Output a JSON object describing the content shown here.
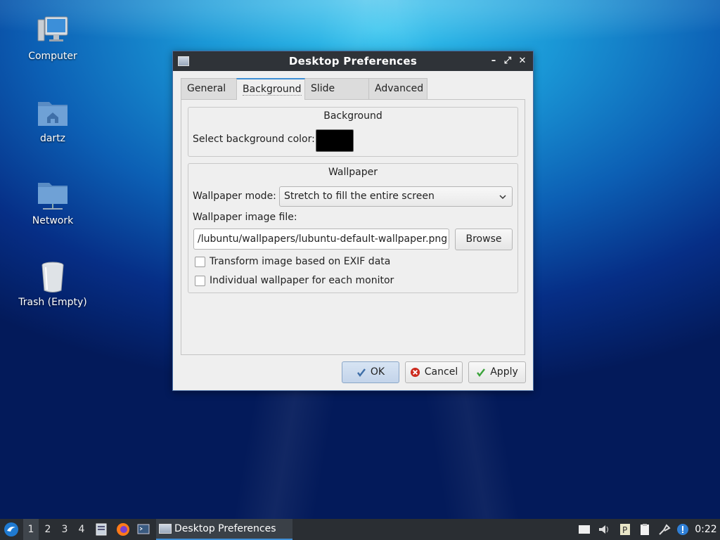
{
  "desktop": {
    "icons": [
      {
        "label": "Computer"
      },
      {
        "label": "dartz"
      },
      {
        "label": "Network"
      },
      {
        "label": "Trash (Empty)"
      }
    ]
  },
  "window": {
    "title": "Desktop Preferences",
    "controls": {
      "minimize": "–",
      "maximize": "⤢",
      "close": "✕"
    },
    "tabs": [
      {
        "label": "General"
      },
      {
        "label": "Background",
        "active": true
      },
      {
        "label": "Slide Show"
      },
      {
        "label": "Advanced"
      }
    ],
    "background_group": {
      "title": "Background",
      "color_label": "Select background color:",
      "color_value": "#000000"
    },
    "wallpaper_group": {
      "title": "Wallpaper",
      "mode_label": "Wallpaper mode:",
      "mode_value": "Stretch to fill the entire screen",
      "file_label": "Wallpaper image file:",
      "file_value": "/lubuntu/wallpapers/lubuntu-default-wallpaper.png",
      "browse_label": "Browse",
      "exif_label": "Transform image based on EXIF data",
      "exif_checked": false,
      "per_monitor_label": "Individual wallpaper for each monitor",
      "per_monitor_checked": false
    },
    "buttons": {
      "ok": "OK",
      "cancel": "Cancel",
      "apply": "Apply"
    }
  },
  "taskbar": {
    "workspaces": [
      "1",
      "2",
      "3",
      "4"
    ],
    "active_workspace": "1",
    "task_label": "Desktop Preferences",
    "clock": "0:22",
    "tray_icons": [
      "notes-icon",
      "volume-icon",
      "parcellite-icon",
      "clipboard-icon",
      "network-icon",
      "update-notifier-icon"
    ]
  }
}
